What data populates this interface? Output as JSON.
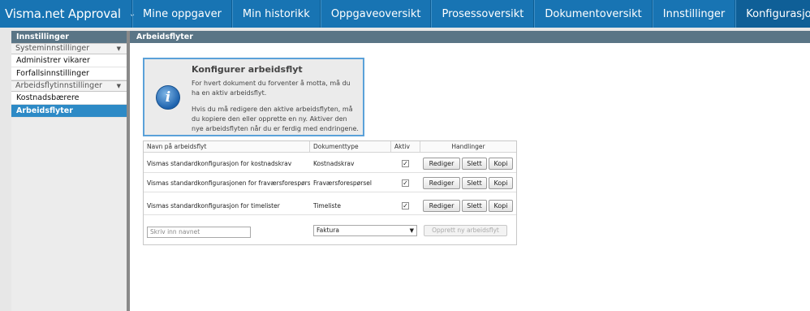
{
  "app": {
    "title": "Visma.net Approval"
  },
  "nav": {
    "tabs": [
      {
        "label": "Mine oppgaver"
      },
      {
        "label": "Min historikk"
      },
      {
        "label": "Oppgaveoversikt"
      },
      {
        "label": "Prosessoversikt"
      },
      {
        "label": "Dokumentoversikt"
      },
      {
        "label": "Innstillinger"
      },
      {
        "label": "Konfigurasjon"
      }
    ],
    "active": "Konfigurasjon"
  },
  "sidebar": {
    "header": "Innstillinger",
    "group1": {
      "label": "Systeminnstillinger",
      "items": [
        "Administrer vikarer",
        "Forfallsinnstillinger"
      ]
    },
    "group2": {
      "label": "Arbeidsflytinnstillinger",
      "items": [
        "Kostnadsbærere",
        "Arbeidsflyter"
      ]
    },
    "active": "Arbeidsflyter"
  },
  "main": {
    "header": "Arbeidsflyter",
    "info": {
      "title": "Konfigurer arbeidsflyt",
      "p1": "For hvert dokument du forventer å motta, må du ha en aktiv arbeidsflyt.",
      "p2": "Hvis du må redigere den aktive arbeidsflyten, må du kopiere den eller opprette en ny. Aktiver den nye arbeidsflyten når du er ferdig med endringene."
    },
    "table": {
      "headers": {
        "name": "Navn på arbeidsflyt",
        "type": "Dokumenttype",
        "active": "Aktiv",
        "actions": "Handlinger"
      },
      "rows": [
        {
          "name": "Vismas standardkonfigurasjon for kostnadskrav",
          "type": "Kostnadskrav",
          "active": true
        },
        {
          "name": "Vismas standardkonfigurasjonen for fraværsforespørsel",
          "type": "Fraværsforespørsel",
          "active": true
        },
        {
          "name": "Vismas standardkonfigurasjon for timelister",
          "type": "Timeliste",
          "active": true
        }
      ],
      "actions": {
        "edit": "Rediger",
        "delete": "Slett",
        "copy": "Kopi"
      },
      "new_name_placeholder": "Skriv inn navnet",
      "new_type_selected": "Faktura",
      "create_button": "Opprett ny arbeidsflyt"
    }
  },
  "icons": {
    "dropdown": "chevron-down-icon",
    "info": "info-icon",
    "check": "checkmark-icon"
  },
  "colors": {
    "nav": "#1874b3",
    "header": "#5a7586",
    "accent": "#2d8ac6"
  }
}
